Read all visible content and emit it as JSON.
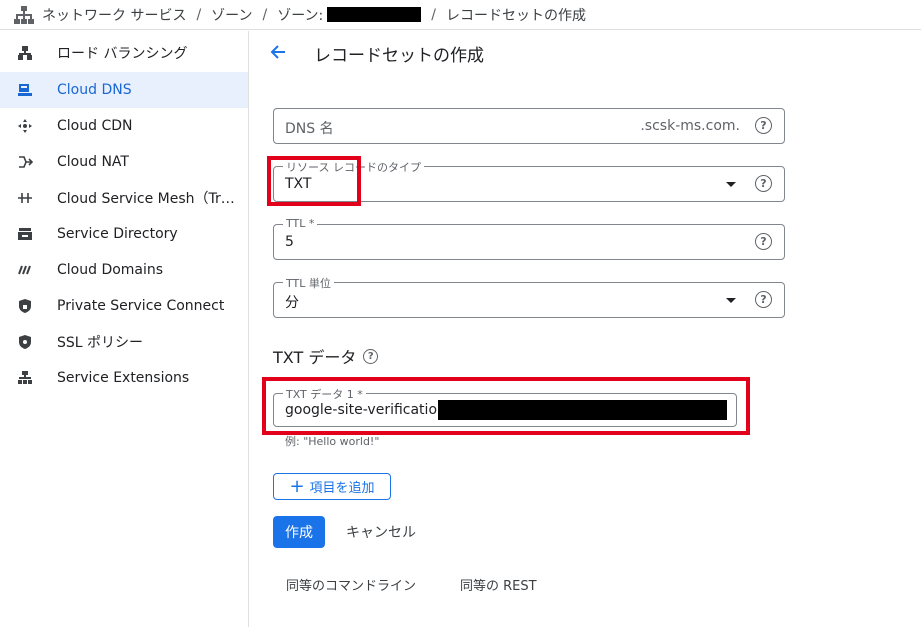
{
  "breadcrumb": {
    "items": [
      "ネットワーク サービス",
      "ゾーン",
      "ゾーン:",
      "レコードセットの作成"
    ],
    "separator": "/",
    "icon": "network-services-icon"
  },
  "sidebar": {
    "items": [
      {
        "label": "ロード バランシング",
        "icon": "load-balancing-icon",
        "active": false
      },
      {
        "label": "Cloud DNS",
        "icon": "dns-icon",
        "active": true
      },
      {
        "label": "Cloud CDN",
        "icon": "cdn-icon",
        "active": false
      },
      {
        "label": "Cloud NAT",
        "icon": "nat-icon",
        "active": false
      },
      {
        "label": "Cloud Service Mesh（Traffic Director）",
        "icon": "service-mesh-icon",
        "active": false
      },
      {
        "label": "Service Directory",
        "icon": "service-directory-icon",
        "active": false
      },
      {
        "label": "Cloud Domains",
        "icon": "domains-icon",
        "active": false
      },
      {
        "label": "Private Service Connect",
        "icon": "private-service-connect-icon",
        "active": false
      },
      {
        "label": "SSL ポリシー",
        "icon": "ssl-policy-icon",
        "active": false
      },
      {
        "label": "Service Extensions",
        "icon": "service-extensions-icon",
        "active": false
      }
    ]
  },
  "page": {
    "title": "レコードセットの作成",
    "back_icon": "arrow-back-icon"
  },
  "form": {
    "dns_name": {
      "placeholder": "DNS 名",
      "suffix": ".scsk-ms.com."
    },
    "record_type": {
      "label": "リソース レコードのタイプ",
      "value": "TXT"
    },
    "ttl": {
      "label": "TTL *",
      "value": "5"
    },
    "ttl_unit": {
      "label": "TTL 単位",
      "value": "分"
    },
    "txt_section": {
      "title": "TXT データ"
    },
    "txt_data_1": {
      "label": "TXT データ 1 *",
      "value": "google-site-verification=",
      "hint": "例: \"Hello world!\""
    },
    "help_glyph": "?"
  },
  "buttons": {
    "add_item": "項目を追加",
    "add_glyph": "+",
    "create": "作成",
    "cancel": "キャンセル",
    "equivalent_cli": "同等のコマンドライン",
    "equivalent_rest": "同等の REST"
  },
  "colors": {
    "accent": "#1a73e8",
    "active_nav_bg": "#e8f0fe",
    "highlight": "#e3001b"
  }
}
